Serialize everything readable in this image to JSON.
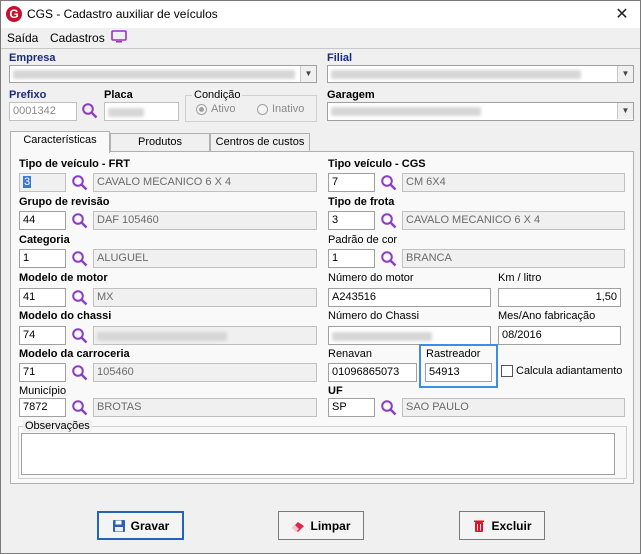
{
  "window": {
    "title": "CGS - Cadastro auxiliar de veículos",
    "app_icon_letter": "G"
  },
  "menu": {
    "items": [
      "Saída",
      "Cadastros"
    ]
  },
  "header": {
    "empresa_label": "Empresa",
    "filial_label": "Filial",
    "prefixo_label": "Prefixo",
    "prefixo_value": "0001342",
    "placa_label": "Placa",
    "condicao_label": "Condição",
    "condicao_options": [
      "Ativo",
      "Inativo"
    ],
    "garagem_label": "Garagem"
  },
  "tabs": [
    "Características",
    "Produtos",
    "Centros de custos"
  ],
  "fields": {
    "tipo_veiculo_frt": {
      "label": "Tipo de veículo - FRT",
      "code": "3",
      "desc": "CAVALO MECANICO 6 X 4"
    },
    "tipo_veiculo_cgs": {
      "label": "Tipo veículo - CGS",
      "code": "7",
      "desc": "CM 6X4"
    },
    "grupo_revisao": {
      "label": "Grupo de revisão",
      "code": "44",
      "desc": "DAF 105460"
    },
    "tipo_frota": {
      "label": "Tipo de frota",
      "code": "3",
      "desc": "CAVALO MECANICO 6 X 4"
    },
    "categoria": {
      "label": "Categoria",
      "code": "1",
      "desc": "ALUGUEL"
    },
    "padrao_cor": {
      "label": "Padrão de cor",
      "code": "1",
      "desc": "BRANCA"
    },
    "modelo_motor": {
      "label": "Modelo de motor",
      "code": "41",
      "desc": "MX"
    },
    "numero_motor": {
      "label": "Número do motor",
      "value": "A243516"
    },
    "km_litro": {
      "label": "Km / litro",
      "value": "1,50"
    },
    "modelo_chassi": {
      "label": "Modelo do chassi",
      "code": "74"
    },
    "numero_chassi": {
      "label": "Número do Chassi"
    },
    "mes_ano": {
      "label": "Mes/Ano fabricação",
      "value": "08/2016"
    },
    "modelo_carroceria": {
      "label": "Modelo da carroceria",
      "code": "71",
      "desc": "105460"
    },
    "renavan": {
      "label": "Renavan",
      "value": "01096865073"
    },
    "rastreador": {
      "label": "Rastreador",
      "value": "54913"
    },
    "calcula_adiantamento": {
      "label": "Calcula adiantamento",
      "checked": false
    },
    "municipio": {
      "label": "Município",
      "code": "7872",
      "desc": "BROTAS"
    },
    "uf": {
      "label": "UF",
      "code": "SP",
      "desc": "SAO PAULO"
    },
    "observacoes": {
      "label": "Observações",
      "value": ""
    }
  },
  "buttons": {
    "gravar": "Gravar",
    "limpar": "Limpar",
    "excluir": "Excluir"
  },
  "colors": {
    "bold_label": "#1a2b7a",
    "accent": "#3b8fe3",
    "search_icon": "#8a3fc4"
  },
  "icons": {
    "search": "magnifier-icon",
    "save": "floppy-icon",
    "clear": "eraser-icon",
    "delete": "trash-icon"
  }
}
